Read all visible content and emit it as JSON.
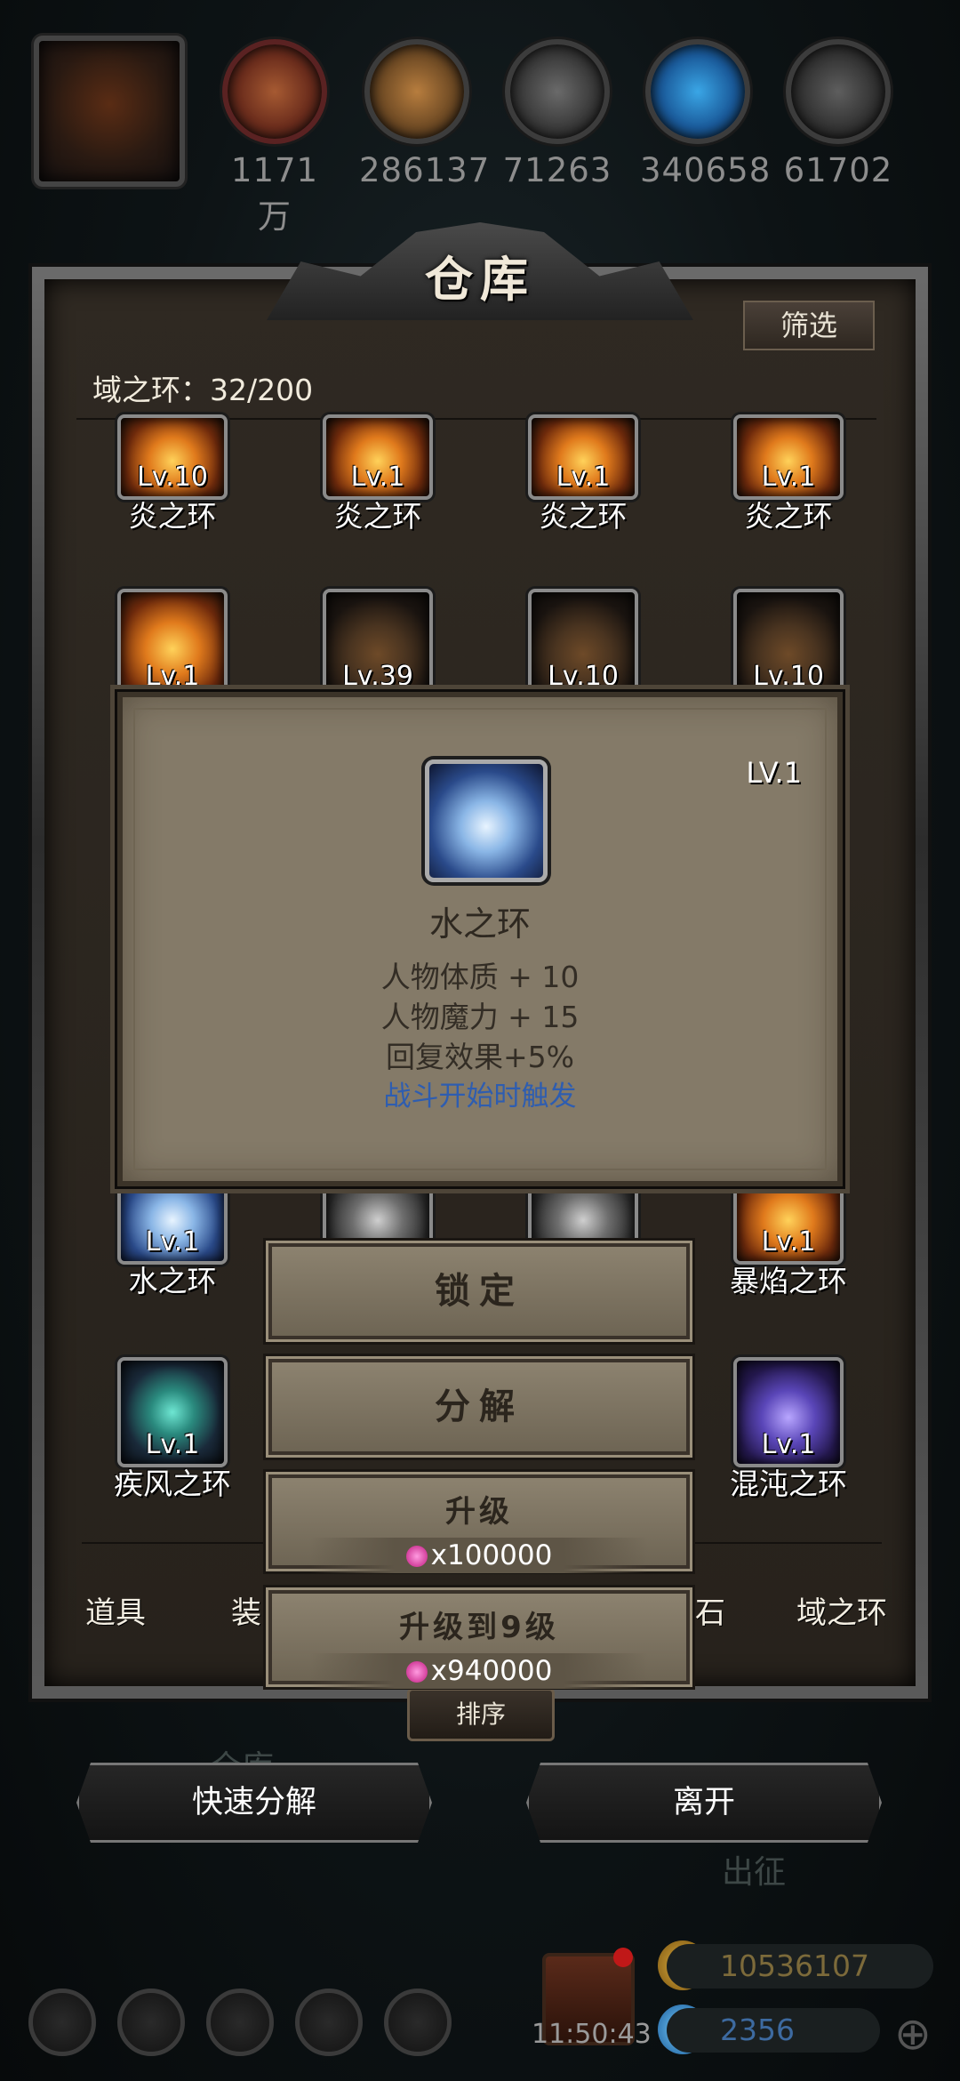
{
  "resources": [
    {
      "icon": "meat-icon",
      "value": "1171万"
    },
    {
      "icon": "wood-icon",
      "value": "286137"
    },
    {
      "icon": "iron-icon",
      "value": "71263"
    },
    {
      "icon": "crystal-icon",
      "value": "340658"
    },
    {
      "icon": "ore-icon",
      "value": "61702"
    }
  ],
  "warehouse": {
    "title": "仓库",
    "filter_label": "筛选",
    "count_label": "域之环：32/200",
    "sort_label": "排序",
    "slots": [
      {
        "level": "Lv.10",
        "name": "炎之环",
        "style": "fire"
      },
      {
        "level": "Lv.1",
        "name": "炎之环",
        "style": "fire"
      },
      {
        "level": "Lv.1",
        "name": "炎之环",
        "style": "fire"
      },
      {
        "level": "Lv.1",
        "name": "炎之环",
        "style": "fire"
      },
      {
        "level": "Lv.1",
        "name": "",
        "style": "fire"
      },
      {
        "level": "Lv.39",
        "name": "",
        "style": "dust"
      },
      {
        "level": "Lv.10",
        "name": "",
        "style": "dust"
      },
      {
        "level": "Lv.10",
        "name": "",
        "style": "dust"
      },
      {
        "level": "Lv.1",
        "name": "水之环",
        "style": "water"
      },
      {
        "level": "",
        "name": "",
        "style": "silver"
      },
      {
        "level": "",
        "name": "",
        "style": "silver"
      },
      {
        "level": "Lv.1",
        "name": "暴焰之环",
        "style": "fire"
      },
      {
        "level": "Lv.1",
        "name": "疾风之环",
        "style": "wind"
      },
      {
        "level": "Lv.1",
        "name": "混沌之环",
        "style": "chaos"
      }
    ],
    "tabs": [
      "道具",
      "装",
      "石",
      "域之环"
    ]
  },
  "detail": {
    "level": "LV.1",
    "name": "水之环",
    "stats": [
      "人物体质 + 10",
      "人物魔力 + 15",
      "回复效果+5%"
    ],
    "trigger": "战斗开始时触发"
  },
  "actions": {
    "lock": "锁定",
    "decompose": "分解",
    "upgrade": "升级",
    "upgrade_cost": "x100000",
    "upgrade_to": "升级到9级",
    "upgrade_to_cost": "x940000"
  },
  "bottom": {
    "quick_decompose": "快速分解",
    "leave": "离开",
    "faded_warehouse": "仓库",
    "faded_expedition": "出征"
  },
  "hud": {
    "clock": "11:50:43",
    "gold": "10536107",
    "diamonds": "2356"
  }
}
